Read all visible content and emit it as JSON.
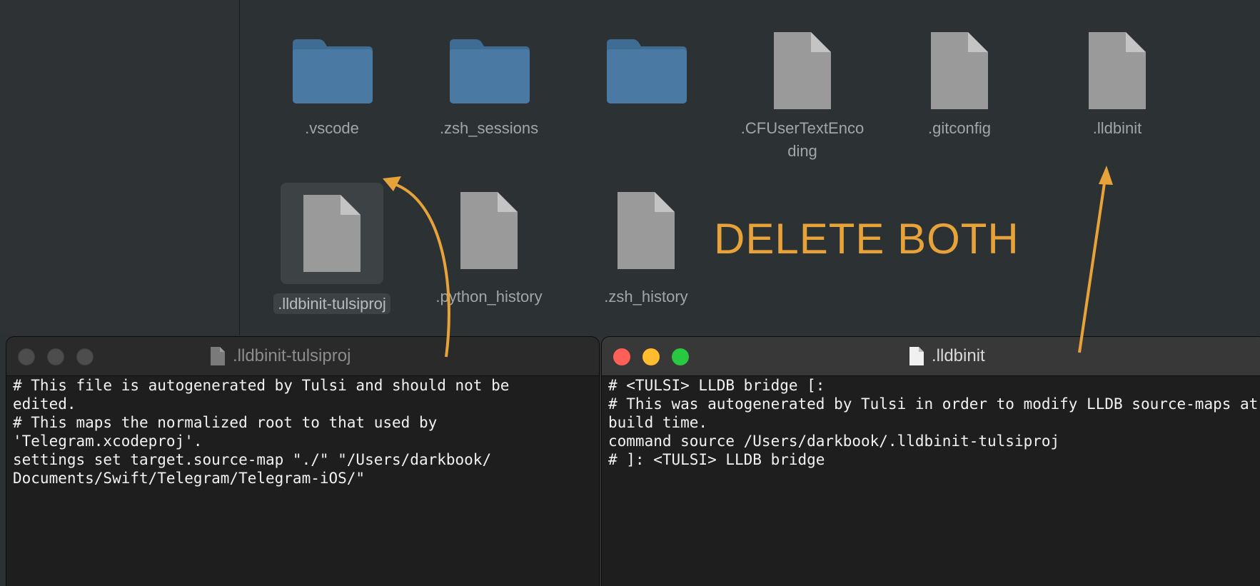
{
  "finder": {
    "items": [
      {
        "label": ".vscode",
        "type": "folder"
      },
      {
        "label": ".zsh_sessions",
        "type": "folder"
      },
      {
        "label": "",
        "type": "folder"
      },
      {
        "label": ".CFUserTextEnco\nding",
        "type": "file"
      },
      {
        "label": ".gitconfig",
        "type": "file"
      },
      {
        "label": ".lldbinit",
        "type": "file"
      },
      {
        "label": ".lldbinit-tulsiproj",
        "type": "file",
        "selected": true
      },
      {
        "label": ".python_history",
        "type": "file"
      },
      {
        "label": ".zsh_history",
        "type": "file"
      }
    ]
  },
  "annotation": {
    "text": "DELETE BOTH",
    "color": "#e7a33a"
  },
  "windows": {
    "left": {
      "title": ".lldbinit-tulsiproj",
      "content": "# This file is autogenerated by Tulsi and should not be\nedited.\n# This maps the normalized root to that used by\n'Telegram.xcodeproj'.\nsettings set target.source-map \"./\" \"/Users/darkbook/\nDocuments/Swift/Telegram/Telegram-iOS/\""
    },
    "right": {
      "title": ".lldbinit",
      "content": "# <TULSI> LLDB bridge [:\n# This was autogenerated by Tulsi in order to modify LLDB source-maps at\nbuild time.\ncommand source /Users/darkbook/.lldbinit-tulsiproj\n# ]: <TULSI> LLDB bridge"
    }
  },
  "colors": {
    "folder": "#4a7aa3",
    "file": "#9a9a9a",
    "accent_arrow": "#e7a33a"
  },
  "icons": {
    "folder": "folder-icon",
    "file": "document-icon"
  }
}
